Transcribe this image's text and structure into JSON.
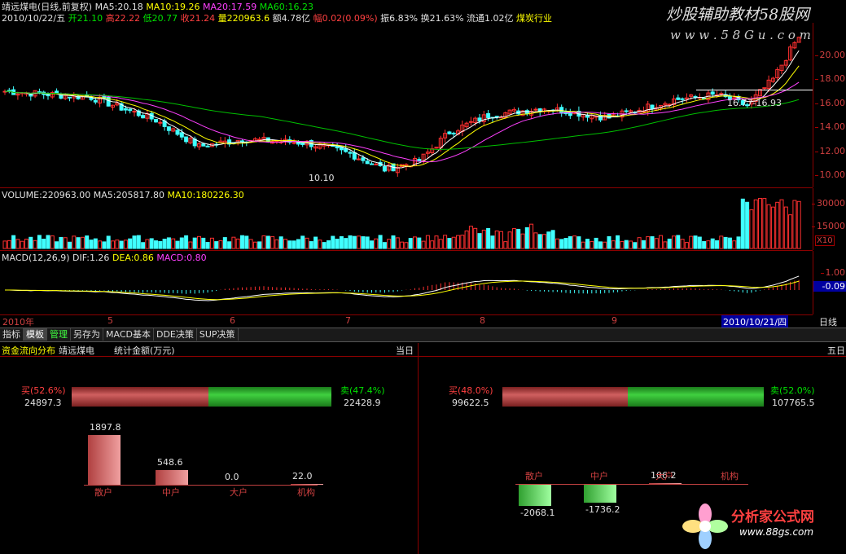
{
  "header": {
    "stock_title": "靖远煤电(日线,前复权)",
    "ma5": "MA5:20.18",
    "ma10": "MA10:19.26",
    "ma20": "MA20:17.59",
    "ma60": "MA60:16.23",
    "date": "2010/10/22/五",
    "open": "开21.10",
    "high": "高22.22",
    "low": "低20.77",
    "close": "收21.24",
    "volume": "量220963.6",
    "amount": "额4.78亿",
    "change": "幅0.02(0.09%)",
    "amplitude": "振6.83%",
    "turnover": "换21.63%",
    "float": "流通1.02亿",
    "industry": "煤炭行业"
  },
  "watermark_top": "炒股辅助教材58股网",
  "watermark_url": "w w w . 5 8 G u . c o m",
  "price_axis": [
    "20.00",
    "18.00",
    "16.00",
    "14.00",
    "12.00",
    "10.00"
  ],
  "price_annotations": {
    "low_label": "10.10",
    "range_label": "16.77-16.93"
  },
  "volume_panel": {
    "title": "VOLUME:220963.00",
    "ma5": "MA5:205817.80",
    "ma10": "MA10:180226.30",
    "axis": [
      "30000",
      "15000"
    ],
    "unit": "X10"
  },
  "macd_panel": {
    "title": "MACD(12,26,9)",
    "dif": "DIF:1.26",
    "dea": "DEA:0.86",
    "macd": "MACD:0.80",
    "axis": [
      "1.00",
      "-0.09"
    ]
  },
  "time_axis": {
    "labels": [
      "2010年",
      "5",
      "6",
      "7",
      "8",
      "9"
    ],
    "current": "2010/10/21/四",
    "period": "日线"
  },
  "tabs": [
    "指标",
    "模板",
    "管理",
    "另存为",
    "MACD基本",
    "DDE决策",
    "SUP决策"
  ],
  "flow": {
    "title": "资金流向分布",
    "stock": "靖远煤电",
    "unit": "统计金额(万元)",
    "today_label": "当日",
    "five_label": "五日",
    "today": {
      "buy_pct": "买(52.6%)",
      "buy_val": "24897.3",
      "sell_pct": "卖(47.4%)",
      "sell_val": "22428.9",
      "buy_ratio": 0.526,
      "bars": [
        {
          "name": "散户",
          "value": 1897.8,
          "label": "1897.8"
        },
        {
          "name": "中户",
          "value": 548.6,
          "label": "548.6"
        },
        {
          "name": "大户",
          "value": 0.0,
          "label": "0.0"
        },
        {
          "name": "机构",
          "value": 22.0,
          "label": "22.0"
        }
      ]
    },
    "five": {
      "buy_pct": "买(48.0%)",
      "buy_val": "99622.5",
      "sell_pct": "卖(52.0%)",
      "sell_val": "107765.5",
      "buy_ratio": 0.48,
      "bars": [
        {
          "name": "散户",
          "value": -2068.1,
          "label": "-2068.1"
        },
        {
          "name": "中户",
          "value": -1736.2,
          "label": "-1736.2"
        },
        {
          "name": "大户",
          "value": 106.2,
          "label": "106.2"
        },
        {
          "name": "机构",
          "value": 0,
          "label": ""
        }
      ]
    }
  },
  "watermark_bottom": "分析家公式网",
  "watermark_bottom_url": "www.88gs.com",
  "colors": {
    "up": "#ff3030",
    "down": "#40ffff",
    "ma5": "#ffffff",
    "ma10": "#ffff00",
    "ma20": "#ff40ff",
    "ma60": "#00c000"
  }
}
